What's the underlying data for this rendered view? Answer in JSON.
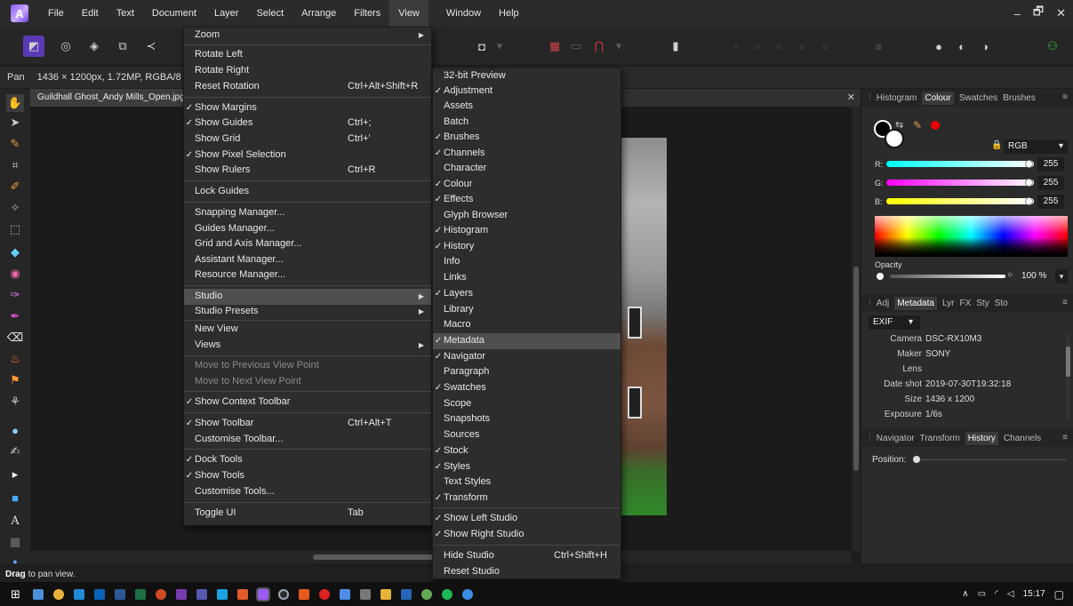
{
  "menubar": {
    "items": [
      "File",
      "Edit",
      "Text",
      "Document",
      "Layer",
      "Select",
      "Arrange",
      "Filters",
      "View",
      "Window",
      "Help"
    ],
    "active": "View"
  },
  "window_controls": {
    "minimize": "–",
    "restore": "🗗",
    "close": "✕"
  },
  "context_toolbar": {
    "tool": "Pan",
    "info": "1436 × 1200px, 1.72MP, RGBA/8 -"
  },
  "document_tab": {
    "name": "Guildhall Ghost_Andy Mills_Open.jpg",
    "close": "✕"
  },
  "view_menu": {
    "items": [
      {
        "label": "Zoom",
        "submenu": true
      },
      {
        "label": "Rotate Left"
      },
      {
        "label": "Rotate Right"
      },
      {
        "label": "Reset Rotation",
        "shortcut": "Ctrl+Alt+Shift+R"
      },
      {
        "label": "Show Margins",
        "checked": true
      },
      {
        "label": "Show Guides",
        "checked": true,
        "shortcut": "Ctrl+;"
      },
      {
        "label": "Show Grid",
        "shortcut": "Ctrl+'"
      },
      {
        "label": "Show Pixel Selection",
        "checked": true
      },
      {
        "label": "Show Rulers",
        "shortcut": "Ctrl+R"
      },
      {
        "label": "Lock Guides"
      },
      {
        "label": "Snapping Manager..."
      },
      {
        "label": "Guides Manager..."
      },
      {
        "label": "Grid and Axis Manager..."
      },
      {
        "label": "Assistant Manager..."
      },
      {
        "label": "Resource Manager..."
      },
      {
        "label": "Studio",
        "submenu": true,
        "highlighted": true
      },
      {
        "label": "Studio Presets",
        "submenu": true
      },
      {
        "label": "New View"
      },
      {
        "label": "Views",
        "submenu": true
      },
      {
        "label": "Move to Previous View Point",
        "disabled": true
      },
      {
        "label": "Move to Next View Point",
        "disabled": true
      },
      {
        "label": "Show Context Toolbar",
        "checked": true
      },
      {
        "label": "Show Toolbar",
        "checked": true,
        "shortcut": "Ctrl+Alt+T"
      },
      {
        "label": "Customise Toolbar..."
      },
      {
        "label": "Dock Tools",
        "checked": true
      },
      {
        "label": "Show Tools",
        "checked": true
      },
      {
        "label": "Customise Tools..."
      },
      {
        "label": "Toggle UI",
        "shortcut": "Tab"
      }
    ]
  },
  "studio_submenu": {
    "items": [
      {
        "label": "32-bit Preview"
      },
      {
        "label": "Adjustment",
        "checked": true
      },
      {
        "label": "Assets"
      },
      {
        "label": "Batch"
      },
      {
        "label": "Brushes",
        "checked": true
      },
      {
        "label": "Channels",
        "checked": true
      },
      {
        "label": "Character"
      },
      {
        "label": "Colour",
        "checked": true
      },
      {
        "label": "Effects",
        "checked": true
      },
      {
        "label": "Glyph Browser"
      },
      {
        "label": "Histogram",
        "checked": true
      },
      {
        "label": "History",
        "checked": true
      },
      {
        "label": "Info"
      },
      {
        "label": "Links"
      },
      {
        "label": "Layers",
        "checked": true
      },
      {
        "label": "Library"
      },
      {
        "label": "Macro"
      },
      {
        "label": "Metadata",
        "checked": true,
        "highlighted": true
      },
      {
        "label": "Navigator",
        "checked": true
      },
      {
        "label": "Paragraph"
      },
      {
        "label": "Swatches",
        "checked": true
      },
      {
        "label": "Scope"
      },
      {
        "label": "Snapshots"
      },
      {
        "label": "Sources"
      },
      {
        "label": "Stock",
        "checked": true
      },
      {
        "label": "Styles",
        "checked": true
      },
      {
        "label": "Text Styles"
      },
      {
        "label": "Transform",
        "checked": true
      },
      {
        "label": "Show Left Studio",
        "checked": true
      },
      {
        "label": "Show Right Studio",
        "checked": true
      },
      {
        "label": "Hide Studio",
        "shortcut": "Ctrl+Shift+H"
      },
      {
        "label": "Reset Studio"
      }
    ]
  },
  "colour_panel": {
    "tabs": [
      "Histogram",
      "Colour",
      "Swatches",
      "Brushes"
    ],
    "active_tab": "Colour",
    "mode": "RGB",
    "channels": [
      {
        "label": "R:",
        "value": "255"
      },
      {
        "label": "G:",
        "value": "255"
      },
      {
        "label": "B:",
        "value": "255"
      }
    ],
    "opacity_label": "Opacity",
    "opacity_value": "100 %"
  },
  "metadata_panel": {
    "tabs": [
      "Adj",
      "Metadata",
      "Lyr",
      "FX",
      "Sty",
      "Sto"
    ],
    "active_tab": "Metadata",
    "preset": "EXIF",
    "rows": [
      {
        "key": "Camera",
        "value": "DSC-RX10M3"
      },
      {
        "key": "Maker",
        "value": "SONY"
      },
      {
        "key": "Lens",
        "value": ""
      },
      {
        "key": "Date shot",
        "value": "2019-07-30T19:32:18"
      },
      {
        "key": "Size",
        "value": "1436 x 1200"
      },
      {
        "key": "Exposure",
        "value": "1/6s"
      }
    ]
  },
  "history_panel": {
    "tabs": [
      "Navigator",
      "Transform",
      "History",
      "Channels"
    ],
    "active_tab": "History",
    "position_label": "Position:"
  },
  "statusbar": {
    "hint_bold": "Drag",
    "hint_rest": " to pan view."
  },
  "tray": {
    "time": "15:17"
  }
}
